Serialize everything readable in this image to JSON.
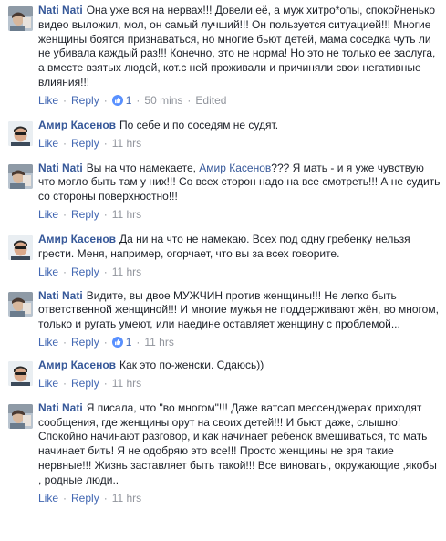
{
  "comments": [
    {
      "author": "Nati Nati",
      "text": "Она уже вся на нервах!!! Довели её, а муж хитро*опы, спокойненько видео выложил, мол, он самый лучший!!! Он пользуется ситуацией!!! Многие женщины боятся признаваться, но многие бьют детей, мама соседка чуть ли не убивала каждый раз!!! Конечно, это не норма! Но это не только ее заслуга, а вместе взятых людей, кот.с ней проживали и причиняли свои негативные влияния!!!",
      "like": "Like",
      "reply": "Reply",
      "reactions": "1",
      "time": "50 mins",
      "edited": "Edited"
    },
    {
      "author": "Амир Касенов",
      "text": "По себе и по соседям не судят.",
      "like": "Like",
      "reply": "Reply",
      "time": "11 hrs"
    },
    {
      "author": "Nati Nati",
      "text_before": "Вы на что намекаете, ",
      "mention": "Амир Касенов",
      "text_after": "??? Я мать - и я уже чувствую что могло быть там у них!!! Со всех сторон надо на все смотреть!!! А не судить со стороны поверхностно!!!",
      "like": "Like",
      "reply": "Reply",
      "time": "11 hrs"
    },
    {
      "author": "Амир Касенов",
      "text": "Да ни на что не намекаю. Всех под одну гребенку нельзя грести. Меня, например, огорчает, что вы за всех говорите.",
      "like": "Like",
      "reply": "Reply",
      "time": "11 hrs"
    },
    {
      "author": "Nati Nati",
      "text": "Видите, вы двое МУЖЧИН против женщины!!! Не легко быть ответственной женщиной!!! И многие мужья не поддерживают жён, во многом, только и ругать умеют, или наедине оставляет женщину с проблемой...",
      "like": "Like",
      "reply": "Reply",
      "reactions": "1",
      "time": "11 hrs"
    },
    {
      "author": "Амир Касенов",
      "text": "Как это по-женски. Сдаюсь))",
      "like": "Like",
      "reply": "Reply",
      "time": "11 hrs"
    },
    {
      "author": "Nati Nati",
      "text": "Я писала, что \"во многом\"!!! Даже ватсап мессенджерах приходят сообщения, где женщины орут на своих детей!!! И бьют даже, слышно! Спокойно начинают разговор, и как начинает ребенок вмешиваться, то мать начинает бить! Я не одобряю это все!!! Просто женщины не зря такие нервные!!! Жизнь заставляет быть такой!!! Все виноваты, окружающие ,якобы , родные люди..",
      "like": "Like",
      "reply": "Reply",
      "time": "11 hrs"
    }
  ],
  "colors": {
    "link": "#365899",
    "action": "#4267b2",
    "muted": "#90949c",
    "like_badge": "#5890ff"
  }
}
